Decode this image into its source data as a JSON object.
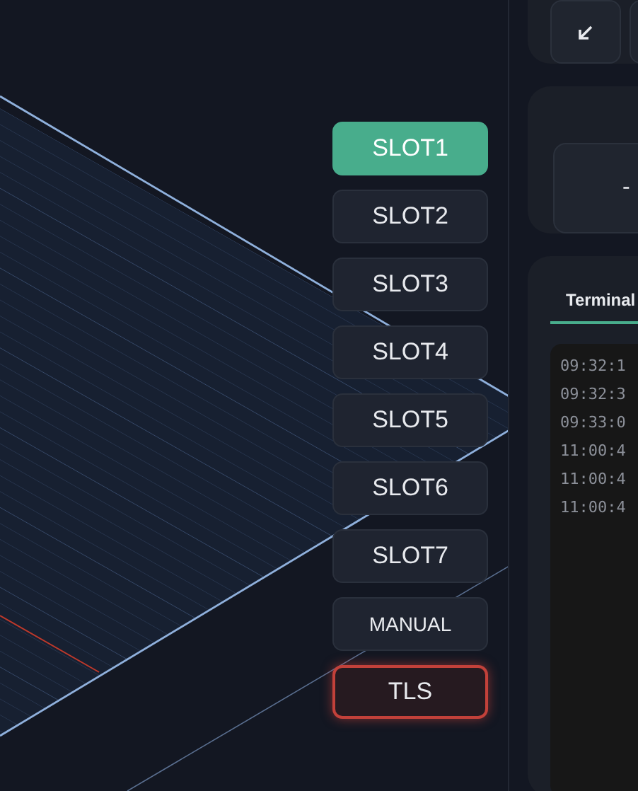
{
  "slots": [
    {
      "label": "SLOT1",
      "selected": true,
      "kind": "slot"
    },
    {
      "label": "SLOT2",
      "selected": false,
      "kind": "slot"
    },
    {
      "label": "SLOT3",
      "selected": false,
      "kind": "slot"
    },
    {
      "label": "SLOT4",
      "selected": false,
      "kind": "slot"
    },
    {
      "label": "SLOT5",
      "selected": false,
      "kind": "slot"
    },
    {
      "label": "SLOT6",
      "selected": false,
      "kind": "slot"
    },
    {
      "label": "SLOT7",
      "selected": false,
      "kind": "slot"
    },
    {
      "label": "MANUAL",
      "selected": false,
      "kind": "manual"
    },
    {
      "label": "TLS",
      "selected": false,
      "kind": "alert"
    }
  ],
  "position": {
    "value": "-"
  },
  "tabs": [
    {
      "label": "Terminal",
      "selected": true
    }
  ],
  "terminal": {
    "lines": [
      "09:32:1",
      "09:32:3",
      "09:33:0",
      "11:00:4",
      "11:00:4",
      "11:00:4"
    ]
  }
}
